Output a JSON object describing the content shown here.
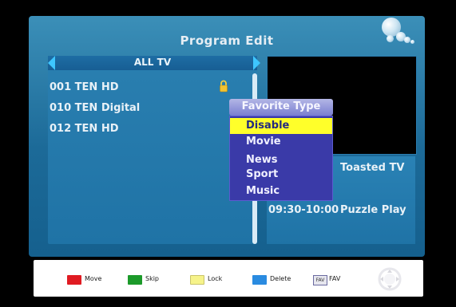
{
  "window": {
    "title": "Program Edit"
  },
  "list": {
    "title": "ALL TV",
    "channels": [
      {
        "label": "001 TEN HD",
        "locked": true
      },
      {
        "label": "010 TEN Digital",
        "locked": false
      },
      {
        "label": "012 TEN HD",
        "locked": false
      }
    ]
  },
  "favorite_popup": {
    "title": "Favorite Type",
    "options": [
      "Disable",
      "Movie",
      "News",
      "Sport",
      "Music"
    ],
    "selected": "Disable"
  },
  "epg": {
    "now_title": "Toasted TV",
    "next_time": "09:30-10:00",
    "next_title": "Puzzle Play"
  },
  "footer": {
    "move": "Move",
    "skip": "Skip",
    "lock": "Lock",
    "delete": "Delete",
    "fav_chip": "FAV",
    "fav": "FAV"
  },
  "colors": {
    "move": "#e01b22",
    "skip": "#1c9a2a",
    "lock": "#f6f38a",
    "delete": "#2a8be0",
    "highlight": "#ffff2a"
  },
  "icons": {
    "lock": "lock-icon",
    "nav": "directional-pad-icon",
    "logo": "bubbles-logo-icon"
  }
}
